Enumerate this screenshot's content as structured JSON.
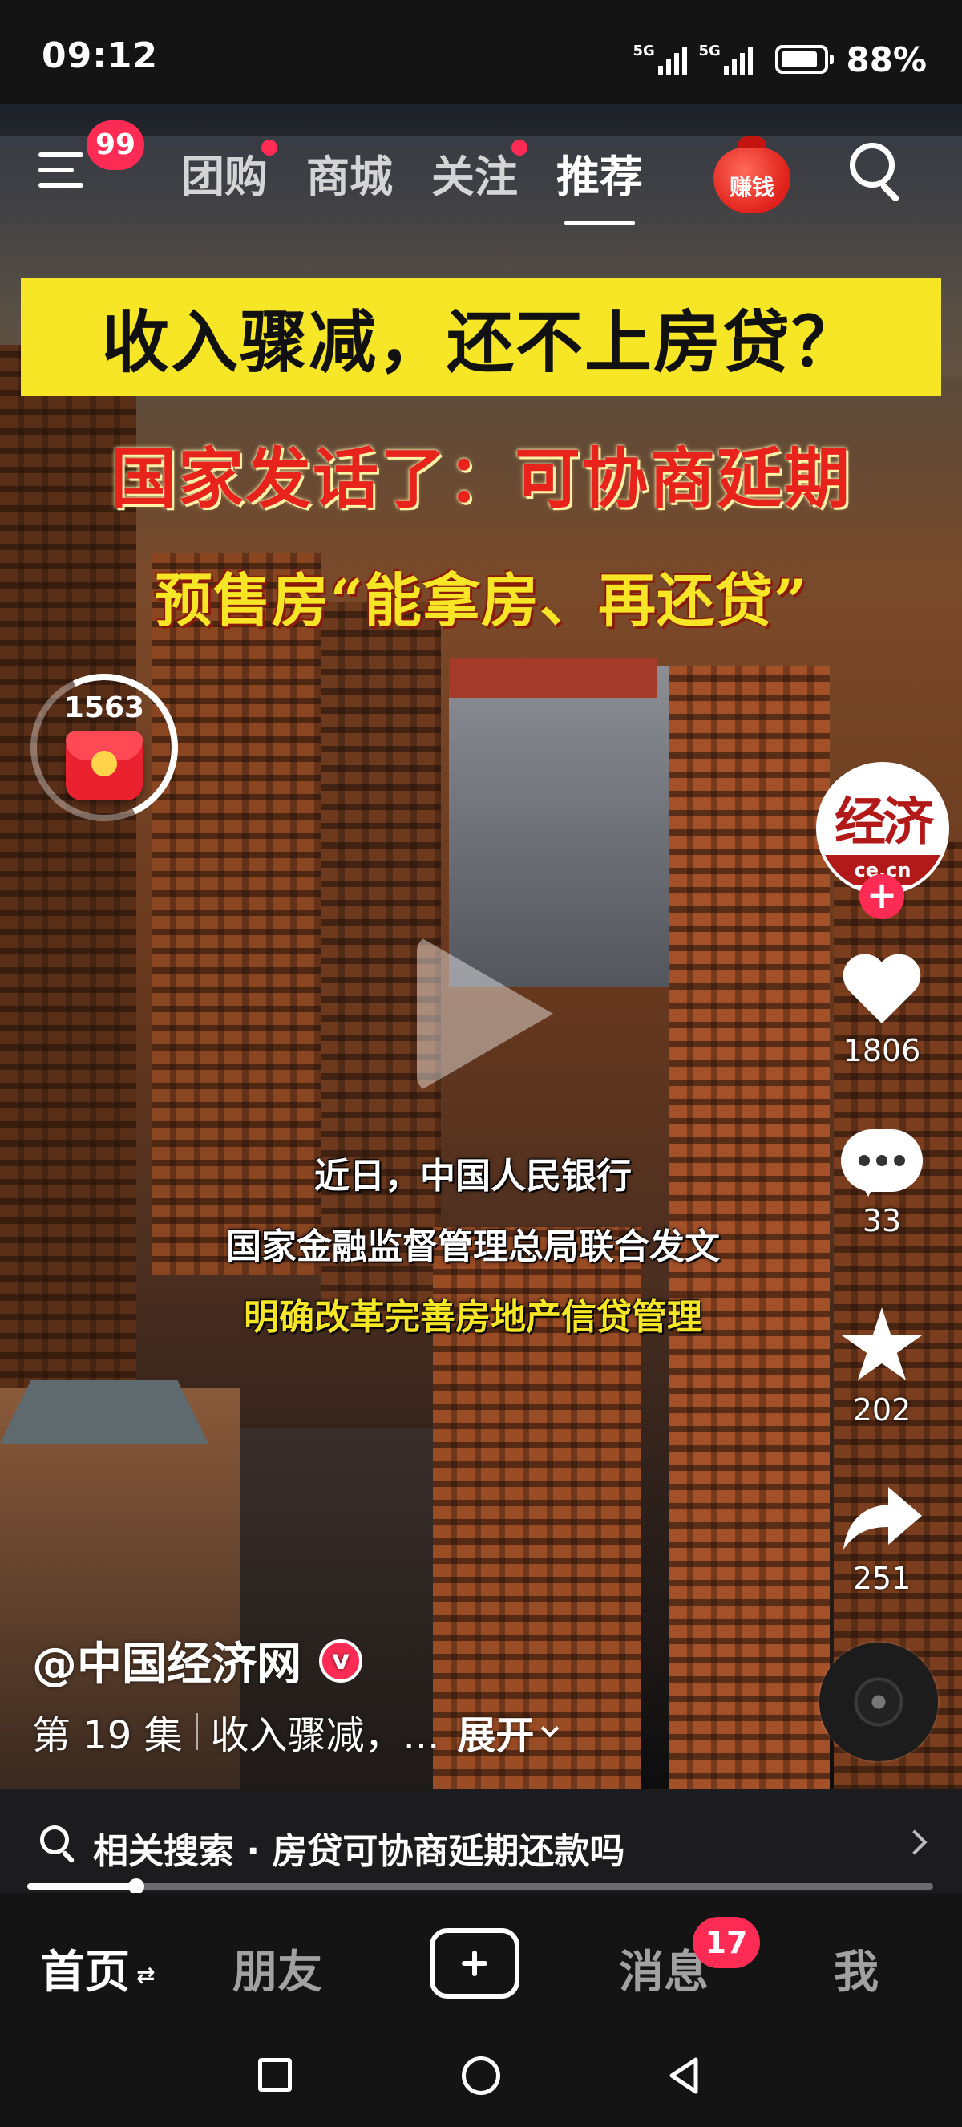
{
  "status_bar": {
    "time": "09:12",
    "signal_1_label": "5G",
    "signal_2_label": "5G",
    "battery": "88%",
    "battery_level": 0.88
  },
  "top_nav": {
    "menu_badge": "99",
    "tabs": [
      {
        "label": "团购",
        "dot": true
      },
      {
        "label": "商城",
        "dot": false
      },
      {
        "label": "关注",
        "dot": true
      },
      {
        "label": "推荐",
        "dot": false,
        "active": true
      }
    ],
    "earn_label": "赚钱",
    "search_icon": "search-icon"
  },
  "video": {
    "headline": "收入骤减，还不上房贷？",
    "subhead_1": "国家发话了：可协商延期",
    "subhead_2": "预售房“能拿房、再还贷”",
    "captions": [
      "近日，中国人民银行",
      "国家金融监督管理总局联合发文",
      "明确改革完善房地产信贷管理"
    ],
    "red_packet_count": "1563",
    "red_packet_progress": 0.35
  },
  "actions": {
    "avatar_text": "经济",
    "avatar_subtext": "ce.cn",
    "likes": "1806",
    "comments": "33",
    "favorites": "202",
    "shares": "251"
  },
  "author": {
    "name": "@中国经济网",
    "verified_label": "v"
  },
  "description": {
    "episode": "第 19 集",
    "text": "收入骤减，...",
    "expand": "展开"
  },
  "related_search": {
    "label": "相关搜索 · 房贷可协商延期还款吗"
  },
  "progress": 0.12,
  "tab_bar": {
    "home": "首页",
    "friends": "朋友",
    "messages": "消息",
    "messages_badge": "17",
    "me": "我"
  },
  "colors": {
    "accent": "#fe2c55",
    "headline_bg": "#f7e626",
    "subhead_red": "#e8231c"
  }
}
